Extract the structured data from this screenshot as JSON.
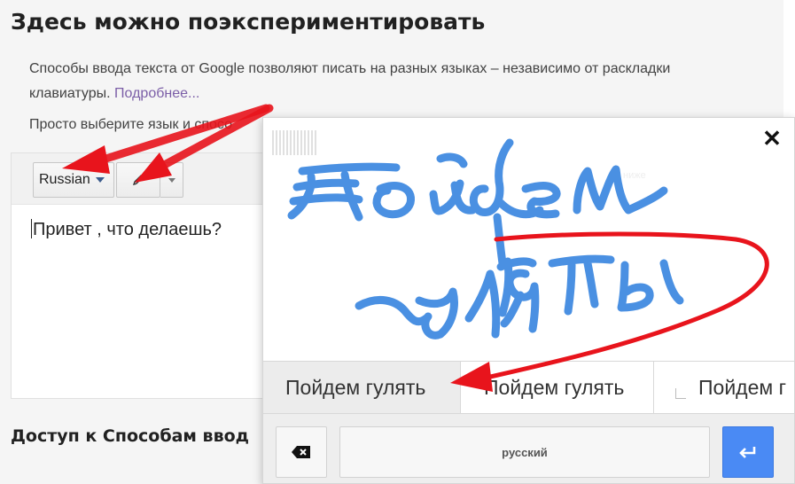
{
  "page": {
    "title": "Здесь можно поэкспериментировать",
    "intro_text": "Способы ввода текста от Google позволяют писать на разных языках – независимо от раскладки клавиатуры.",
    "more_link": "Подробнее...",
    "choose_text": "Просто выберите язык и спосо",
    "access_heading": "Доступ к Способам ввод"
  },
  "demo": {
    "language_label": "Russian",
    "input_text": "Привет , что делаешь?"
  },
  "handwriting": {
    "candidates": [
      "Пойдем гулять",
      "Пойдем гулять",
      "Пойдем г"
    ],
    "space_label": "русский",
    "ink_color": "#4a90e2"
  },
  "annotations": {
    "arrow_color": "#e8141c"
  },
  "icons": {
    "close": "close-icon",
    "pencil": "pencil-icon",
    "backspace": "backspace-icon",
    "enter": "enter-icon"
  }
}
